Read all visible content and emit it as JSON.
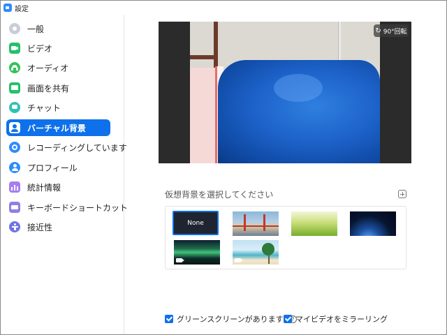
{
  "window": {
    "title": "設定"
  },
  "sidebar": {
    "items": [
      {
        "label": "一般",
        "icon": "gear-icon",
        "color": "#c9ced6",
        "active": false
      },
      {
        "label": "ビデオ",
        "icon": "video-camera-icon",
        "color": "#23c16b",
        "active": false
      },
      {
        "label": "オーディオ",
        "icon": "headphones-icon",
        "color": "#35c25a",
        "active": false
      },
      {
        "label": "画面を共有",
        "icon": "screen-share-icon",
        "color": "#23c16b",
        "active": false
      },
      {
        "label": "チャット",
        "icon": "chat-bubble-icon",
        "color": "#2fc2b4",
        "active": false
      },
      {
        "label": "バーチャル背景",
        "icon": "virtual-background-icon",
        "color": "#ffffff",
        "active": true
      },
      {
        "label": "レコーディングしています",
        "icon": "record-icon",
        "color": "#2d8cff",
        "active": false
      },
      {
        "label": "プロフィール",
        "icon": "person-icon",
        "color": "#2d8cff",
        "active": false
      },
      {
        "label": "統計情報",
        "icon": "bar-chart-icon",
        "color": "#a77ef0",
        "active": false
      },
      {
        "label": "キーボードショートカット",
        "icon": "keyboard-icon",
        "color": "#8f7ee8",
        "active": false
      },
      {
        "label": "接近性",
        "icon": "accessibility-icon",
        "color": "#6f73e6",
        "active": false
      }
    ]
  },
  "preview": {
    "rotate_label": "90°回転",
    "rotate_icon": "rotate-icon"
  },
  "backgrounds": {
    "title": "仮想背景を選択してください",
    "add_icon": "plus-icon",
    "none_label": "None",
    "items": [
      {
        "name": "none",
        "selected": true
      },
      {
        "name": "golden-gate-bridge",
        "selected": false
      },
      {
        "name": "grass",
        "selected": false
      },
      {
        "name": "earth-from-space",
        "selected": false
      },
      {
        "name": "aurora",
        "video": true,
        "selected": false
      },
      {
        "name": "beach",
        "video": true,
        "selected": false
      }
    ]
  },
  "options": {
    "green_screen_label": "グリーンスクリーンがあります",
    "green_screen_checked": true,
    "mirror_label": "マイビデオをミラーリング",
    "mirror_checked": true,
    "help_glyph": "?"
  },
  "colors": {
    "accent": "#0e71eb"
  }
}
